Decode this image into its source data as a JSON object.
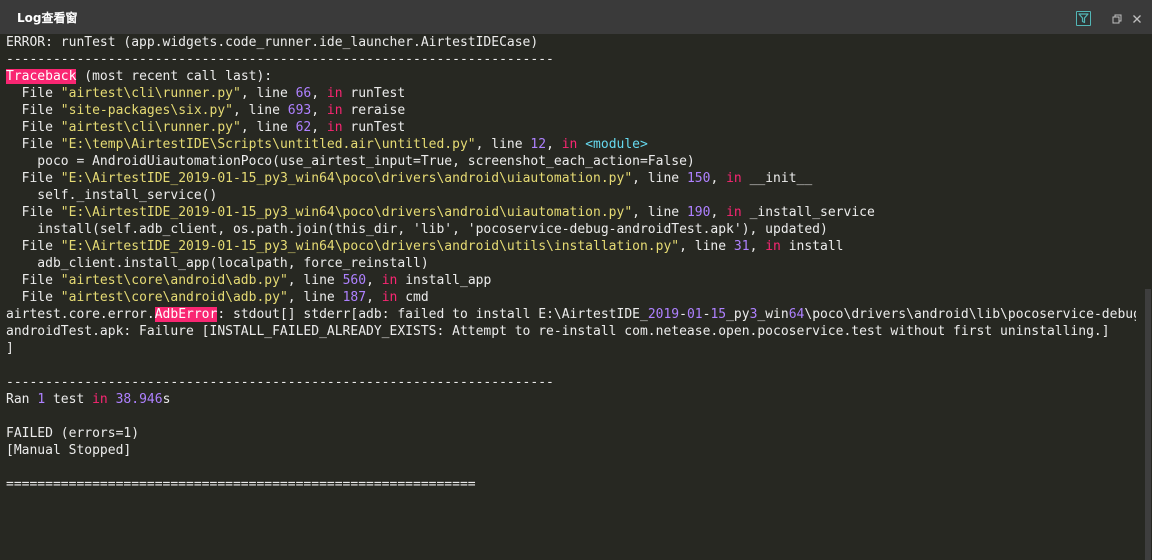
{
  "window": {
    "title": "Log查看窗",
    "controls": {
      "filter_icon": "filter-icon",
      "restore_icon": "restore-icon",
      "close_icon": "close-icon"
    }
  },
  "colors": {
    "background": "#272822",
    "titlebar": "#3a3a3a",
    "text": "#ececec",
    "string": "#e6db74",
    "number": "#ae81ff",
    "keyword": "#f92672",
    "builtin": "#66d9ef",
    "highlight": "#f92672"
  },
  "log_lines": [
    [
      [
        "ERROR: runTest (app.widgets.code_runner.ide_launcher.AirtestIDECase)",
        ""
      ]
    ],
    [
      [
        "----------------------------------------------------------------------",
        ""
      ]
    ],
    [
      [
        "Traceback",
        "h"
      ],
      [
        " (most recent call last):",
        ""
      ]
    ],
    [
      [
        "  File ",
        ""
      ],
      [
        "\"airtest\\cli\\runner.py\"",
        "s"
      ],
      [
        ", line ",
        ""
      ],
      [
        "66",
        "n"
      ],
      [
        ", ",
        ""
      ],
      [
        "in",
        "k"
      ],
      [
        " runTest",
        ""
      ]
    ],
    [
      [
        "  File ",
        ""
      ],
      [
        "\"site-packages\\six.py\"",
        "s"
      ],
      [
        ", line ",
        ""
      ],
      [
        "693",
        "n"
      ],
      [
        ", ",
        ""
      ],
      [
        "in",
        "k"
      ],
      [
        " reraise",
        ""
      ]
    ],
    [
      [
        "  File ",
        ""
      ],
      [
        "\"airtest\\cli\\runner.py\"",
        "s"
      ],
      [
        ", line ",
        ""
      ],
      [
        "62",
        "n"
      ],
      [
        ", ",
        ""
      ],
      [
        "in",
        "k"
      ],
      [
        " runTest",
        ""
      ]
    ],
    [
      [
        "  File ",
        ""
      ],
      [
        "\"E:\\temp\\AirtestIDE\\Scripts\\untitled.air\\untitled.py\"",
        "s"
      ],
      [
        ", line ",
        ""
      ],
      [
        "12",
        "n"
      ],
      [
        ", ",
        ""
      ],
      [
        "in",
        "k"
      ],
      [
        " ",
        ""
      ],
      [
        "<module>",
        "b"
      ]
    ],
    [
      [
        "    poco = AndroidUiautomationPoco(use_airtest_input=True, screenshot_each_action=False)",
        ""
      ]
    ],
    [
      [
        "  File ",
        ""
      ],
      [
        "\"E:\\AirtestIDE_2019-01-15_py3_win64\\poco\\drivers\\android\\uiautomation.py\"",
        "s"
      ],
      [
        ", line ",
        ""
      ],
      [
        "150",
        "n"
      ],
      [
        ", ",
        ""
      ],
      [
        "in",
        "k"
      ],
      [
        " __init__",
        ""
      ]
    ],
    [
      [
        "    self._install_service()",
        ""
      ]
    ],
    [
      [
        "  File ",
        ""
      ],
      [
        "\"E:\\AirtestIDE_2019-01-15_py3_win64\\poco\\drivers\\android\\uiautomation.py\"",
        "s"
      ],
      [
        ", line ",
        ""
      ],
      [
        "190",
        "n"
      ],
      [
        ", ",
        ""
      ],
      [
        "in",
        "k"
      ],
      [
        " _install_service",
        ""
      ]
    ],
    [
      [
        "    install(self.adb_client, os.path.join(this_dir, 'lib', 'pocoservice-debug-androidTest.apk'), updated)",
        ""
      ]
    ],
    [
      [
        "  File ",
        ""
      ],
      [
        "\"E:\\AirtestIDE_2019-01-15_py3_win64\\poco\\drivers\\android\\utils\\installation.py\"",
        "s"
      ],
      [
        ", line ",
        ""
      ],
      [
        "31",
        "n"
      ],
      [
        ", ",
        ""
      ],
      [
        "in",
        "k"
      ],
      [
        " install",
        ""
      ]
    ],
    [
      [
        "    adb_client.install_app(localpath, force_reinstall)",
        ""
      ]
    ],
    [
      [
        "  File ",
        ""
      ],
      [
        "\"airtest\\core\\android\\adb.py\"",
        "s"
      ],
      [
        ", line ",
        ""
      ],
      [
        "560",
        "n"
      ],
      [
        ", ",
        ""
      ],
      [
        "in",
        "k"
      ],
      [
        " install_app",
        ""
      ]
    ],
    [
      [
        "  File ",
        ""
      ],
      [
        "\"airtest\\core\\android\\adb.py\"",
        "s"
      ],
      [
        ", line ",
        ""
      ],
      [
        "187",
        "n"
      ],
      [
        ", ",
        ""
      ],
      [
        "in",
        "k"
      ],
      [
        " cmd",
        ""
      ]
    ],
    [
      [
        "airtest.core.error.",
        ""
      ],
      [
        "AdbError",
        "h"
      ],
      [
        ": stdout[] stderr[adb: failed to install E:\\AirtestIDE_",
        ""
      ],
      [
        "2019",
        "n"
      ],
      [
        "-",
        ""
      ],
      [
        "01",
        "n"
      ],
      [
        "-",
        ""
      ],
      [
        "15",
        "n"
      ],
      [
        "_py",
        ""
      ],
      [
        "3",
        "n"
      ],
      [
        "_win",
        ""
      ],
      [
        "64",
        "n"
      ],
      [
        "\\poco\\drivers\\android\\lib\\pocoservice-debug-",
        ""
      ]
    ],
    [
      [
        "androidTest.apk: Failure [INSTALL_FAILED_ALREADY_EXISTS: Attempt to re-install com.netease.open.pocoservice.test without first uninstalling.]",
        ""
      ]
    ],
    [
      [
        "]",
        ""
      ]
    ],
    [
      [
        "",
        ""
      ]
    ],
    [
      [
        "----------------------------------------------------------------------",
        ""
      ]
    ],
    [
      [
        "Ran ",
        ""
      ],
      [
        "1",
        "n"
      ],
      [
        " test ",
        ""
      ],
      [
        "in",
        "k"
      ],
      [
        " ",
        ""
      ],
      [
        "38.946",
        "n"
      ],
      [
        "s",
        ""
      ]
    ],
    [
      [
        "",
        ""
      ]
    ],
    [
      [
        "FAILED (errors=1)",
        ""
      ]
    ],
    [
      [
        "[Manual Stopped]",
        ""
      ]
    ],
    [
      [
        "",
        ""
      ]
    ],
    [
      [
        "============================================================",
        ""
      ]
    ]
  ]
}
